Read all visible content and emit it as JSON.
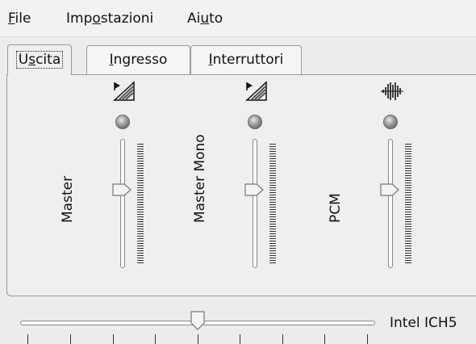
{
  "menu": {
    "items": [
      {
        "pre": "",
        "mnemonic": "F",
        "post": "ile"
      },
      {
        "pre": "Imp",
        "mnemonic": "o",
        "post": "stazioni"
      },
      {
        "pre": "Ai",
        "mnemonic": "u",
        "post": "to"
      }
    ]
  },
  "tabs": [
    {
      "pre": "U",
      "mnemonic": "s",
      "post": "cita",
      "active": true
    },
    {
      "pre": "",
      "mnemonic": "I",
      "post": "ngresso",
      "active": false
    },
    {
      "pre": "",
      "mnemonic": "I",
      "post": "nterruttori",
      "active": false
    }
  ],
  "channels": [
    {
      "label": "Master",
      "icon": "volume-ramp-icon",
      "level": 0.62
    },
    {
      "label": "Master Mono",
      "icon": "volume-ramp-icon",
      "level": 0.62
    },
    {
      "label": "PCM",
      "icon": "waveform-icon",
      "level": 0.62
    }
  ],
  "master_slider": {
    "device_label": "Intel ICH5",
    "level": 0.5
  },
  "colors": {
    "panel_border": "#9a9a9a",
    "tick": "#333333"
  }
}
